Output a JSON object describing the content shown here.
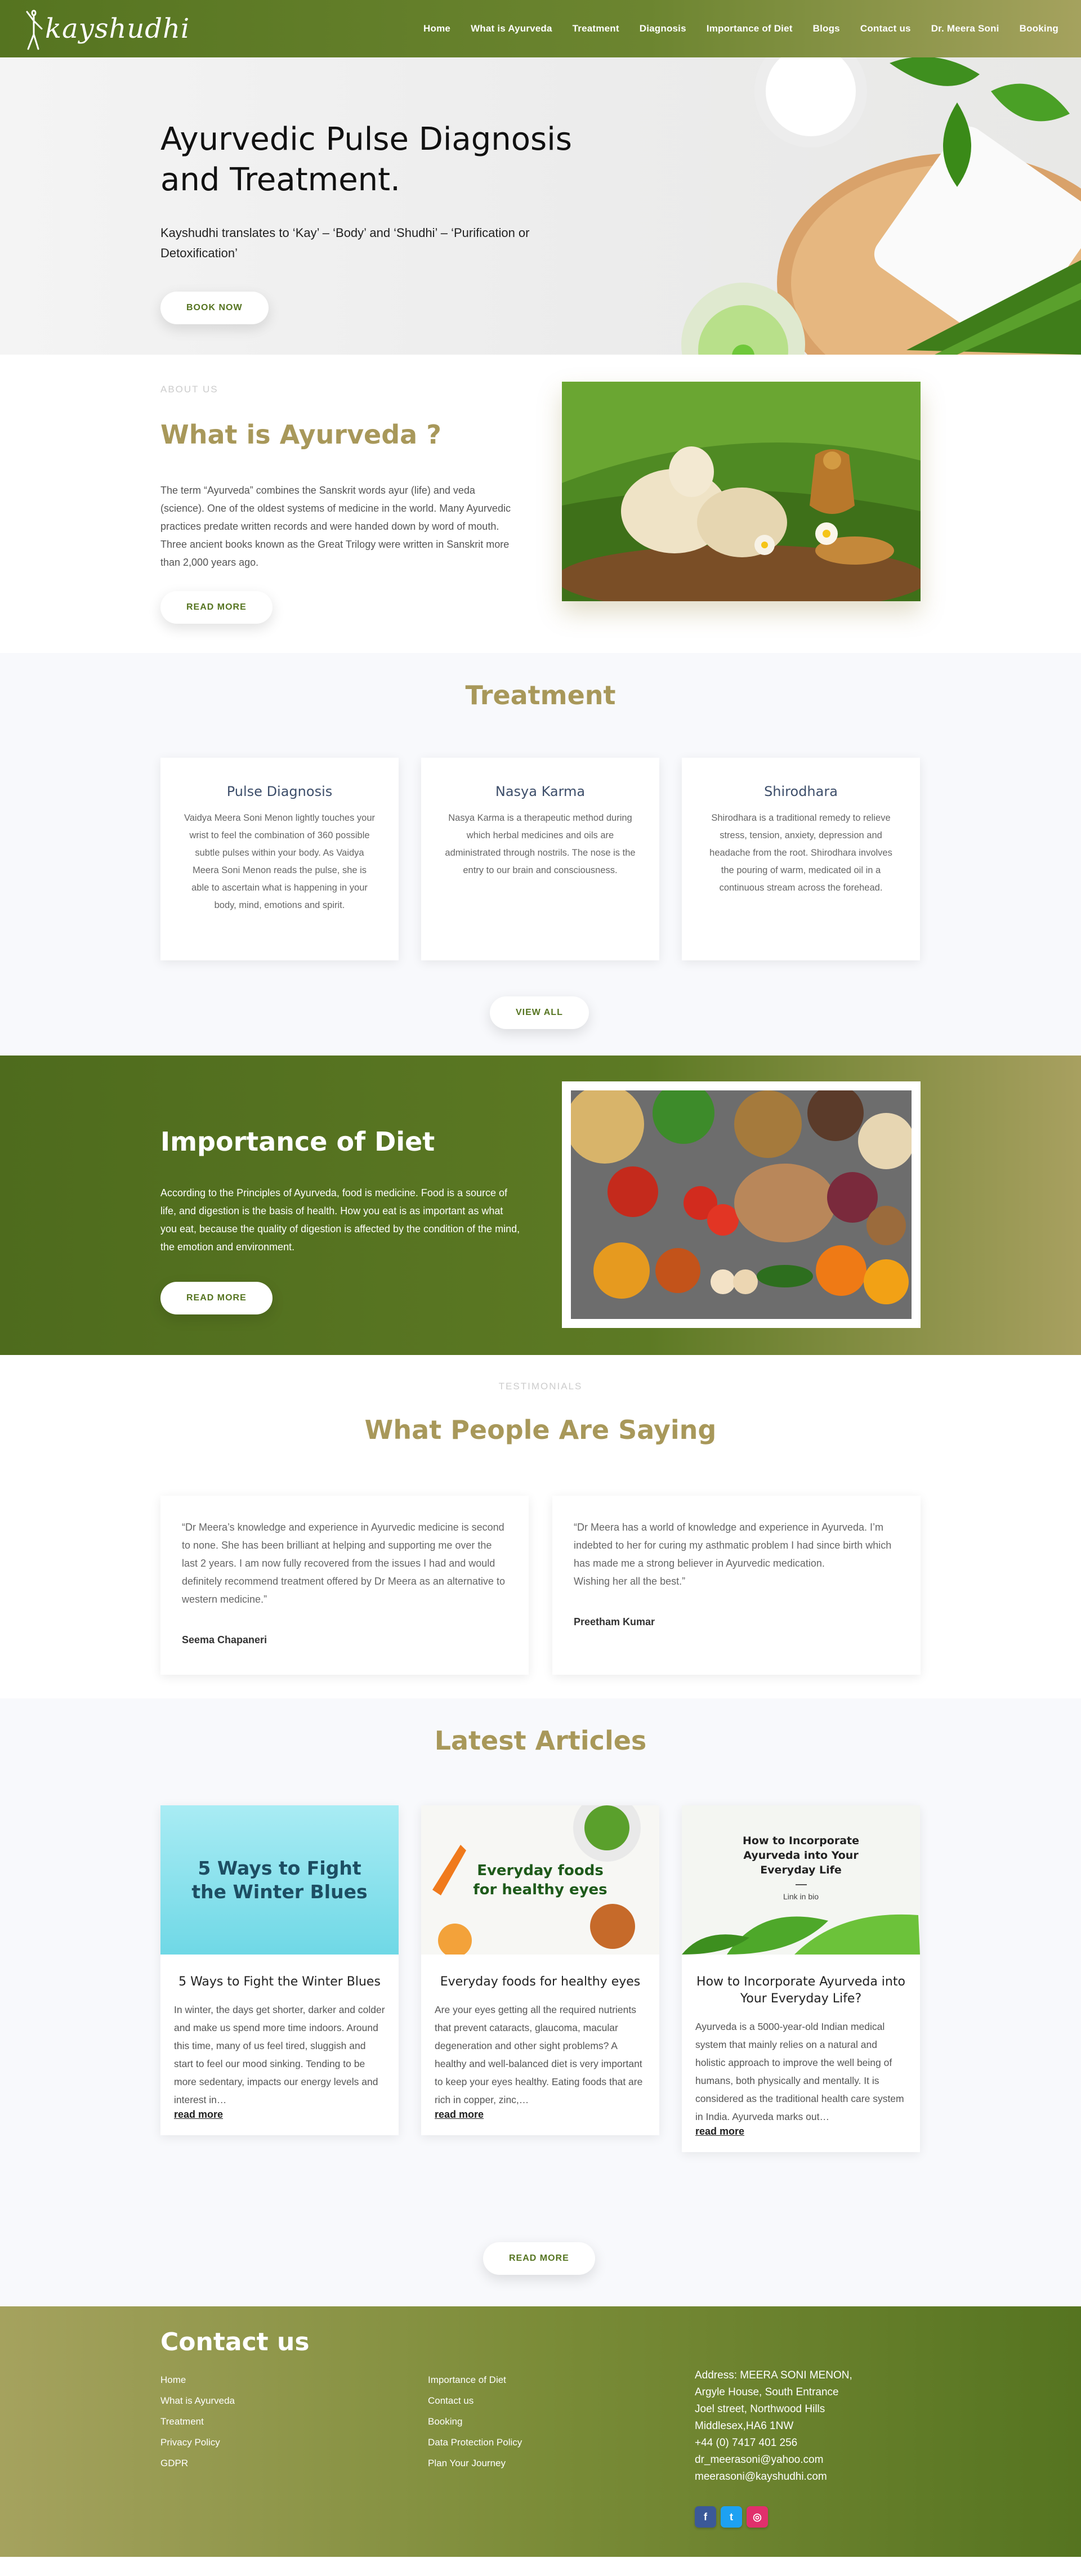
{
  "header": {
    "logo": "kayshudhi",
    "nav": [
      "Home",
      "What is Ayurveda",
      "Treatment",
      "Diagnosis",
      "Importance of Diet",
      "Blogs",
      "Contact us",
      "Dr. Meera Soni",
      "Booking"
    ]
  },
  "hero": {
    "title": "Ayurvedic Pulse Diagnosis and Treatment.",
    "subtitle": "Kayshudhi translates to ‘Kay’ – ‘Body’ and ‘Shudhi’ – ‘Purification or Detoxification’",
    "button": "BOOK NOW"
  },
  "about": {
    "eyebrow": "ABOUT US",
    "title": "What is Ayurveda ?",
    "text": "The term “Ayurveda” combines the Sanskrit words ayur (life) and veda (science). One of the oldest systems of medicine in the world. Many Ayurvedic practices predate written records and were handed down by word of mouth. Three ancient books known as the Great Trilogy were written in Sanskrit more than 2,000 years ago.",
    "button": "READ MORE"
  },
  "treatment": {
    "title": "Treatment",
    "cards": [
      {
        "title": "Pulse Diagnosis",
        "text": "Vaidya Meera Soni Menon lightly touches your wrist to feel the combination of 360 possible subtle pulses within your body. As Vaidya Meera Soni Menon reads the pulse, she is able to ascertain what is happening in your body, mind, emotions and spirit."
      },
      {
        "title": "Nasya Karma",
        "text": "Nasya Karma is a therapeutic method during which herbal medicines and oils are administrated through nostrils. The nose is the entry to our brain and consciousness."
      },
      {
        "title": "Shirodhara",
        "text": "Shirodhara is a traditional remedy to relieve stress, tension, anxiety, depression and headache from the root. Shirodhara involves the pouring of warm, medicated oil in a continuous stream across the forehead."
      }
    ],
    "button": "VIEW ALL"
  },
  "diet": {
    "title": "Importance of Diet",
    "text": "According to the Principles of Ayurveda, food is medicine. Food is a source of life, and digestion is the basis of health. How you eat is as important as what you eat, because the quality of digestion is affected by the condition of the mind, the emotion and environment.",
    "button": "READ MORE"
  },
  "testimonials": {
    "eyebrow": "TESTIMONIALS",
    "title": "What People Are Saying",
    "items": [
      {
        "quote": "“Dr Meera’s knowledge and experience in Ayurvedic medicine is second to none. She has been brilliant at helping and supporting me over the last 2 years. I am now fully recovered from the issues I had and would definitely recommend treatment offered by Dr Meera as an alternative to western medicine.”",
        "author": "Seema Chapaneri"
      },
      {
        "quote": "“Dr Meera has a world of knowledge and experience in Ayurveda. I’m indebted to her for curing my asthmatic problem I had since birth which has made me a strong believer in Ayurvedic medication.\nWishing her all the best.”",
        "author": "Preetham Kumar"
      }
    ]
  },
  "articles": {
    "title": "Latest Articles",
    "items": [
      {
        "thumb": "5 Ways to Fight the Winter Blues",
        "title": "5 Ways to Fight the Winter Blues",
        "excerpt": "In winter, the days get shorter, darker and colder and make us spend more time indoors. Around this time, many of us feel tired, sluggish and start to feel our mood sinking. Tending to be more sedentary, impacts our energy levels and interest in…",
        "link": "read more"
      },
      {
        "thumb": "Everyday foods for healthy eyes",
        "title": "Everyday foods for healthy eyes",
        "excerpt": "Are your eyes getting all the required nutrients that prevent cataracts, glaucoma, macular degeneration and other sight problems? A healthy and well-balanced diet is very important to keep your eyes healthy. Eating foods that are rich in copper, zinc,…",
        "link": "read more"
      },
      {
        "thumb": "How to Incorporate Ayurveda into Your Everyday Life",
        "thumb_sub": "Link in bio",
        "title": "How to Incorporate Ayurveda into Your Everyday Life?",
        "excerpt": "Ayurveda is a 5000-year-old Indian medical system that mainly relies on a natural and holistic approach to improve the well being of humans, both physically and mentally. It is considered as the traditional health care system in India. Ayurveda marks out…",
        "link": "read more"
      }
    ],
    "button": "READ MORE"
  },
  "footer": {
    "title": "Contact us",
    "col1": [
      "Home",
      "What is Ayurveda",
      "Treatment",
      "Privacy Policy",
      "GDPR"
    ],
    "col2": [
      "Importance of Diet",
      "Contact us",
      "Booking",
      "Data Protection Policy",
      "Plan Your Journey"
    ],
    "address": [
      "Address: MEERA SONI MENON,",
      "Argyle House, South Entrance",
      "Joel street, Northwood Hills",
      "Middlesex,HA6 1NW",
      "+44 (0) 7417 401 256",
      "dr_meerasoni@yahoo.com",
      "meerasoni@kayshudhi.com"
    ],
    "socials": [
      {
        "icon": "facebook-icon",
        "glyph": "f",
        "color": "#3b5998"
      },
      {
        "icon": "twitter-icon",
        "glyph": "t",
        "color": "#1da1f2"
      },
      {
        "icon": "instagram-icon",
        "glyph": "◎",
        "color": "#e1306c"
      }
    ]
  }
}
